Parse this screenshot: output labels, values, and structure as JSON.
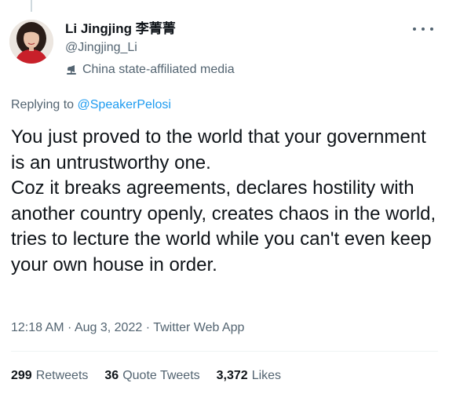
{
  "author": {
    "name": "Li Jingjing 李菁菁",
    "handle": "@Jingjing_Li",
    "label": "China state-affiliated media",
    "label_icon": "microphone-stand-icon"
  },
  "reply": {
    "prefix": "Replying to ",
    "mention": "@SpeakerPelosi"
  },
  "tweet": {
    "text": "You just proved to the world that your government is an untrustworthy one.\nCoz it breaks agreements, declares hostility with another country openly, creates chaos in the world, tries to lecture the world while you can't even keep your own house in order."
  },
  "meta": {
    "time": "12:18 AM",
    "sep1": " · ",
    "date": "Aug 3, 2022",
    "sep2": " · ",
    "source": "Twitter Web App"
  },
  "stats": [
    {
      "count": "299",
      "label": "Retweets"
    },
    {
      "count": "36",
      "label": "Quote Tweets"
    },
    {
      "count": "3,372",
      "label": "Likes"
    }
  ],
  "colors": {
    "link": "#1d9bf0",
    "text": "#0f1419",
    "secondary": "#536471"
  }
}
